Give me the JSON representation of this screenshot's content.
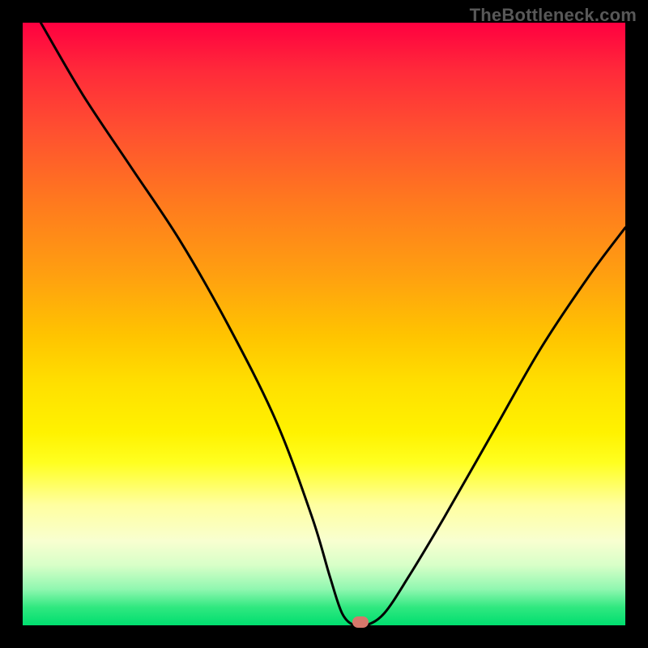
{
  "watermark": "TheBottleneck.com",
  "chart_data": {
    "type": "line",
    "title": "",
    "xlabel": "",
    "ylabel": "",
    "xlim": [
      0,
      100
    ],
    "ylim": [
      0,
      100
    ],
    "series": [
      {
        "name": "bottleneck-curve",
        "x": [
          3,
          10,
          18,
          26,
          34,
          42,
          48,
          51,
          53,
          55,
          57,
          60,
          64,
          70,
          78,
          86,
          94,
          100
        ],
        "values": [
          100,
          88,
          76,
          64,
          50,
          34,
          18,
          8,
          2,
          0,
          0,
          2,
          8,
          18,
          32,
          46,
          58,
          66
        ]
      }
    ],
    "annotations": [
      {
        "name": "optimum-marker",
        "x": 56,
        "y": 0.5
      }
    ],
    "background_gradient": {
      "top": "#ff0040",
      "mid": "#ffe000",
      "bottom": "#00de6f"
    }
  }
}
